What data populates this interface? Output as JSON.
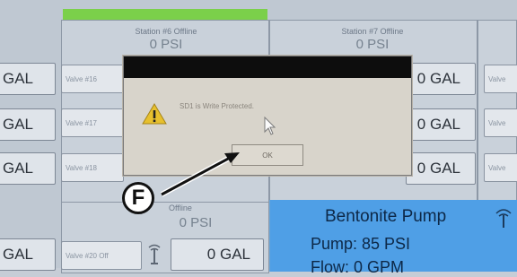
{
  "stations": {
    "s6": {
      "title": "Station #6 Offline",
      "psi": "0 PSI"
    },
    "s7": {
      "title": "Station #7 Offline",
      "psi": "0 PSI"
    },
    "s8": {
      "title": "Offline",
      "psi": "0 PSI"
    }
  },
  "gal_buttons": {
    "left_1": "GAL",
    "left_2": "GAL",
    "left_3": "GAL",
    "left_4": "GAL",
    "mid_1": "0 GAL",
    "mid_2": "0 GAL",
    "mid_3": "0 GAL",
    "bottom": "0 GAL"
  },
  "valves": {
    "v16": "Valve #16",
    "v17": "Valve #17",
    "v18": "Valve #18",
    "v20": "Valve #20 Off",
    "right_1": "Valve",
    "right_2": "Valve",
    "right_3": "Valve"
  },
  "dialog": {
    "message": "SD1 is Write Protected.",
    "ok_label": "OK"
  },
  "bentonite": {
    "title": "Bentonite Pump",
    "pump": "Pump: 85 PSI",
    "flow": "Flow: 0 GPM"
  },
  "callout": {
    "letter": "F"
  },
  "colors": {
    "screen_bg": "#bfc8d2",
    "status_green": "#7bd04a",
    "dialog_title": "#0d0d0d",
    "bentonite_blue": "#4f9fe6"
  }
}
